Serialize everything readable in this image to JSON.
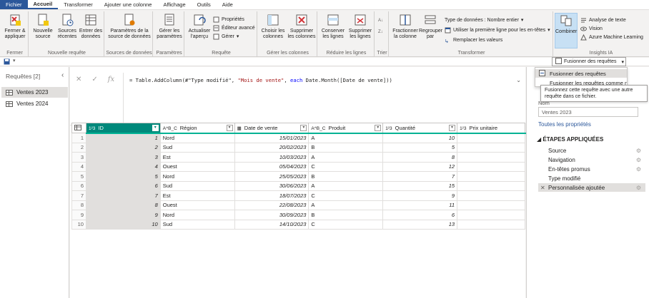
{
  "tabs": [
    "Fichier",
    "Accueil",
    "Transformer",
    "Ajouter une colonne",
    "Affichage",
    "Outils",
    "Aide"
  ],
  "ribbon": {
    "groups": {
      "fermer": "Fermer",
      "nouvelle_requete": "Nouvelle requête",
      "sources": "Sources de données",
      "parametres": "Paramètres",
      "requete": "Requête",
      "gerer_colonnes": "Gérer les colonnes",
      "reduire_lignes": "Réduire les lignes",
      "trier": "Trier",
      "transformer": "Transformer",
      "insights": "Insights IA"
    },
    "buttons": {
      "fermer_appliquer": "Fermer & appliquer",
      "nouvelle_source": "Nouvelle source",
      "sources_recentes": "Sources récentes",
      "entrer_donnees": "Entrer des données",
      "param_source": "Paramètres de la source de données",
      "gerer_param": "Gérer les paramètres",
      "actualiser": "Actualiser l'aperçu",
      "proprietes": "Propriétés",
      "editeur_avance": "Éditeur avancé",
      "gerer": "Gérer",
      "choisir_colonnes": "Choisir les colonnes",
      "supprimer_colonnes": "Supprimer les colonnes",
      "conserver_lignes": "Conserver les lignes",
      "supprimer_lignes": "Supprimer les lignes",
      "fractionner": "Fractionner la colonne",
      "regrouper": "Regrouper par",
      "type_donnees": "Type de données : Nombre entier",
      "premiere_ligne": "Utiliser la première ligne pour les en-têtes",
      "remplacer": "Remplacer les valeurs",
      "combiner": "Combiner",
      "analyse_texte": "Analyse de texte",
      "vision": "Vision",
      "azure_ml": "Azure Machine Learning"
    }
  },
  "combine_dropdown": {
    "split_label": "Fusionner des requêtes",
    "items": [
      "Fusionner des requêtes",
      "Fusionner les requêtes comme nouvelles"
    ],
    "tooltip": "Fusionnez cette requête avec une autre requête dans ce fichier."
  },
  "queries_pane": {
    "title": "Requêtes [2]",
    "items": [
      "Ventes 2023",
      "Ventes 2024"
    ]
  },
  "formula": {
    "prefix": "= Table.AddColumn(#\"Type modifié\", ",
    "str": "\"Mois de vente\"",
    "mid": ", ",
    "kw": "each",
    "suffix": " Date.Month([Date de vente]))"
  },
  "grid": {
    "columns": [
      {
        "type": "1²3",
        "name": "ID"
      },
      {
        "type": "A^B_C",
        "name": "Région"
      },
      {
        "type": "▦",
        "name": "Date de vente"
      },
      {
        "type": "A^B_C",
        "name": "Produit"
      },
      {
        "type": "1²3",
        "name": "Quantité"
      },
      {
        "type": "1²3",
        "name": "Prix unitaire"
      }
    ],
    "rows": [
      [
        "1",
        "1",
        "Nord",
        "15/01/2023",
        "A",
        "10",
        ""
      ],
      [
        "2",
        "2",
        "Sud",
        "20/02/2023",
        "B",
        "5",
        ""
      ],
      [
        "3",
        "3",
        "Est",
        "10/03/2023",
        "A",
        "8",
        ""
      ],
      [
        "4",
        "4",
        "Ouest",
        "05/04/2023",
        "C",
        "12",
        ""
      ],
      [
        "5",
        "5",
        "Nord",
        "25/05/2023",
        "B",
        "7",
        ""
      ],
      [
        "6",
        "6",
        "Sud",
        "30/06/2023",
        "A",
        "15",
        ""
      ],
      [
        "7",
        "7",
        "Est",
        "18/07/2023",
        "C",
        "9",
        ""
      ],
      [
        "8",
        "8",
        "Ouest",
        "22/08/2023",
        "A",
        "11",
        ""
      ],
      [
        "9",
        "9",
        "Nord",
        "30/09/2023",
        "B",
        "6",
        ""
      ],
      [
        "10",
        "10",
        "Sud",
        "14/10/2023",
        "C",
        "13",
        ""
      ]
    ]
  },
  "right_pane": {
    "name_label": "Nom",
    "name_value": "Ventes 2023",
    "all_props": "Toutes les propriétés",
    "steps_title": "ÉTAPES APPLIQUÉES",
    "steps": [
      "Source",
      "Navigation",
      "En-têtes promus",
      "Type modifié",
      "Personnalisée ajoutée"
    ]
  },
  "colors": {
    "accent": "#2b579a",
    "selected_column": "#00897b",
    "quality": "#00b294"
  }
}
